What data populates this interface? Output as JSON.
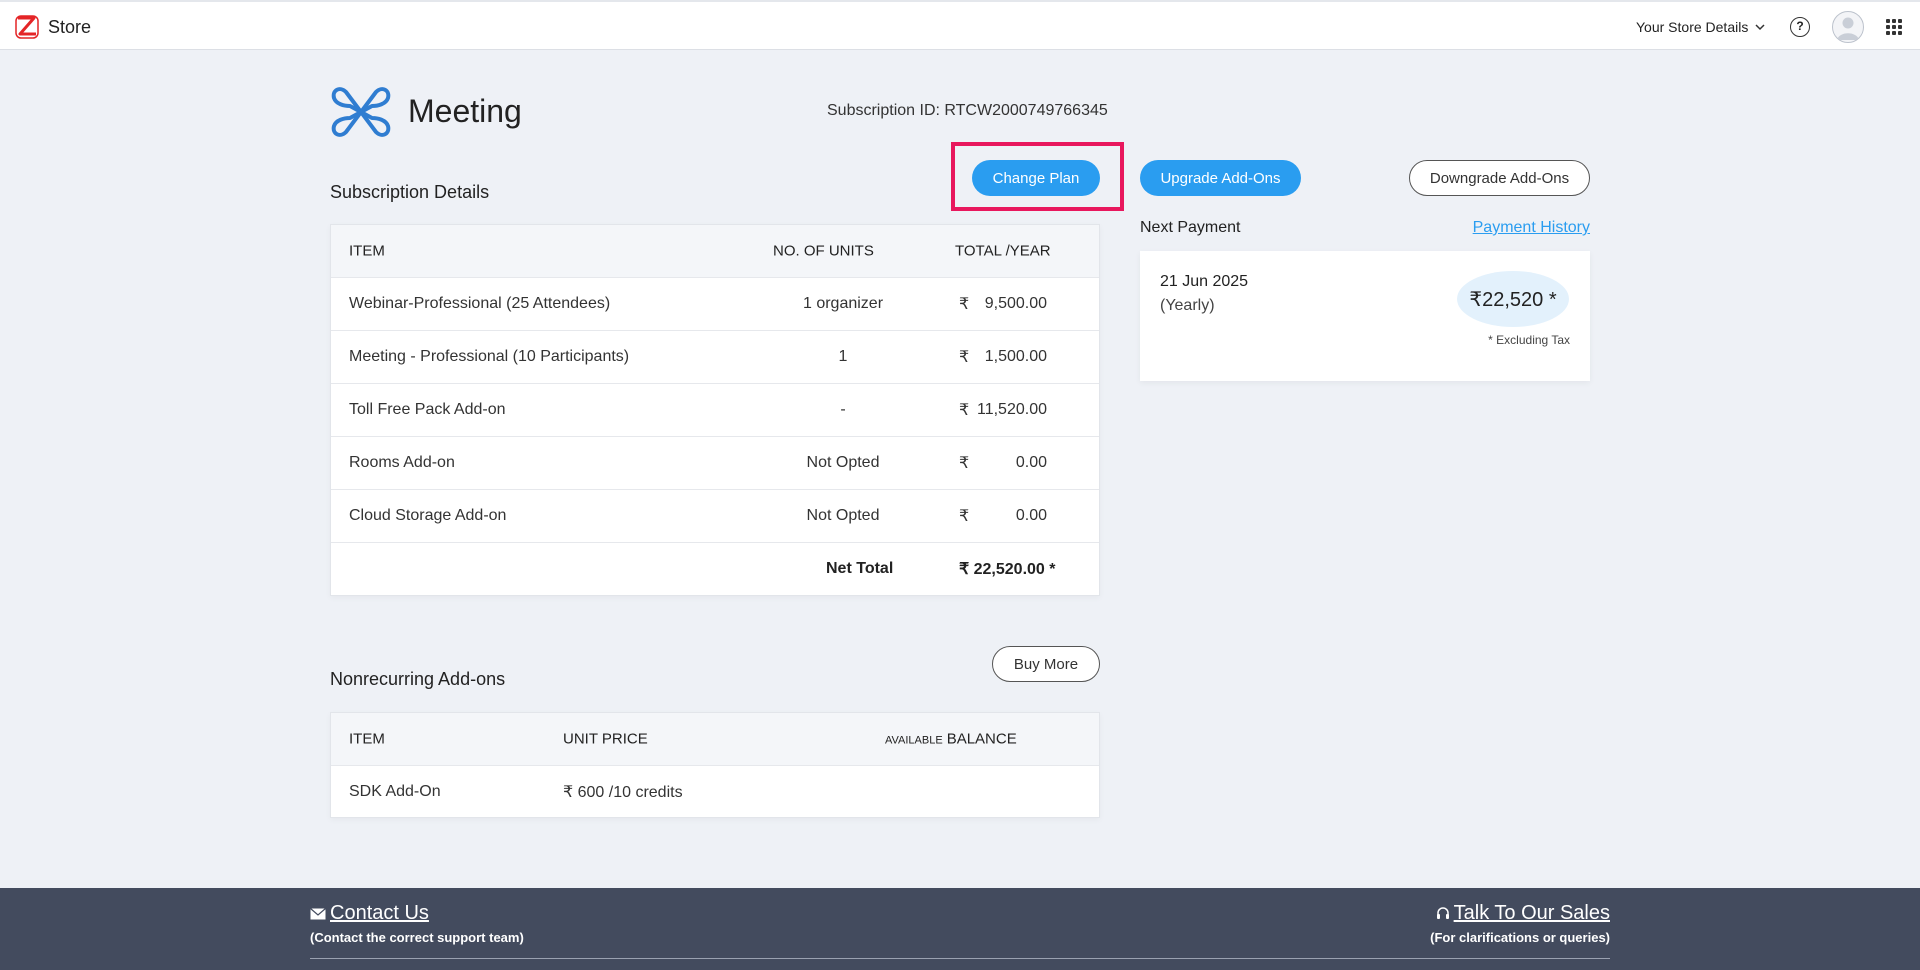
{
  "topbar": {
    "brand": "Store",
    "store_details": "Your Store Details",
    "help_icon": "question-circle-icon",
    "apps_icon": "grid-icon"
  },
  "header": {
    "product_name": "Meeting",
    "subscription_id": "Subscription ID: RTCW2000749766345"
  },
  "buttons": {
    "change_plan": "Change Plan",
    "upgrade_addons": "Upgrade Add-Ons",
    "downgrade_addons": "Downgrade Add-Ons",
    "buy_more": "Buy More"
  },
  "subscription": {
    "title": "Subscription Details",
    "headers": {
      "item": "ITEM",
      "units": "NO. OF UNITS",
      "total": "TOTAL /YEAR"
    },
    "currency": "₹",
    "rows": [
      {
        "item": "Webinar-Professional (25 Attendees)",
        "units": "1 organizer",
        "amount": "9,500.00"
      },
      {
        "item": "Meeting - Professional (10 Participants)",
        "units": "1",
        "amount": "1,500.00"
      },
      {
        "item": "Toll Free Pack Add-on",
        "units": "-",
        "amount": "11,520.00"
      },
      {
        "item": "Rooms Add-on",
        "units": "Not Opted",
        "amount": "0.00"
      },
      {
        "item": "Cloud Storage Add-on",
        "units": "Not Opted",
        "amount": "0.00"
      }
    ],
    "net_total_label": "Net Total",
    "net_total_value": "₹ 22,520.00 *"
  },
  "payment": {
    "label": "Next Payment",
    "history_link": "Payment History",
    "date": "21 Jun 2025",
    "period": "(Yearly)",
    "amount": "₹22,520 *",
    "note": "* Excluding Tax"
  },
  "nonrecurring": {
    "title": "Nonrecurring Add-ons",
    "headers": {
      "item": "ITEM",
      "unit_price": "UNIT PRICE",
      "available": "AVAILABLE",
      "balance": "BALANCE"
    },
    "rows": [
      {
        "item": "SDK Add-On",
        "unit_price": "₹ 600 /10 credits",
        "balance": ""
      }
    ]
  },
  "footer": {
    "contact": "Contact Us",
    "contact_sub": "(Contact the correct support team)",
    "sales": "Talk To Our Sales",
    "sales_sub": "(For clarifications or queries)"
  },
  "colors": {
    "accent": "#2a9df0",
    "highlight": "#e8175d",
    "footer_bg": "#434b5e"
  }
}
